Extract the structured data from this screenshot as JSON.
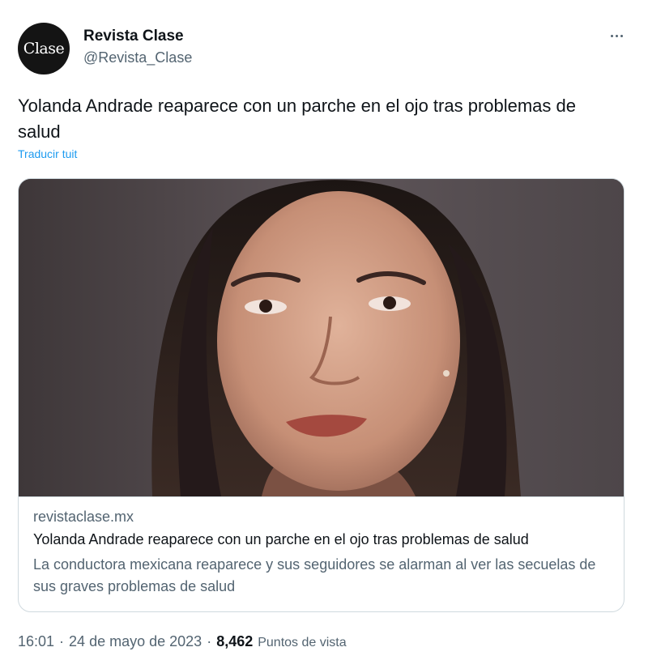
{
  "author": {
    "avatar_text": "Clase",
    "display_name": "Revista Clase",
    "handle": "@Revista_Clase"
  },
  "tweet": {
    "text": "Yolanda Andrade reaparece con un parche en el ojo tras problemas de salud",
    "translate_label": "Traducir tuit"
  },
  "card": {
    "image_alt": "Yolanda Andrade portrait",
    "domain": "revistaclase.mx",
    "title": "Yolanda Andrade reaparece con un parche en el ojo tras problemas de salud",
    "description": "La conductora mexicana reaparece y sus seguidores se alarman al ver las secuelas de sus graves problemas de salud"
  },
  "footer": {
    "time": "16:01",
    "separator": "·",
    "date": "24 de mayo de 2023",
    "views_count": "8,462",
    "views_label": "Puntos de vista"
  },
  "icons": {
    "more": "more-horizontal-icon"
  },
  "colors": {
    "link": "#1d9bf0",
    "secondary_text": "#536471",
    "primary_text": "#0f1419",
    "border": "#cfd9de"
  }
}
